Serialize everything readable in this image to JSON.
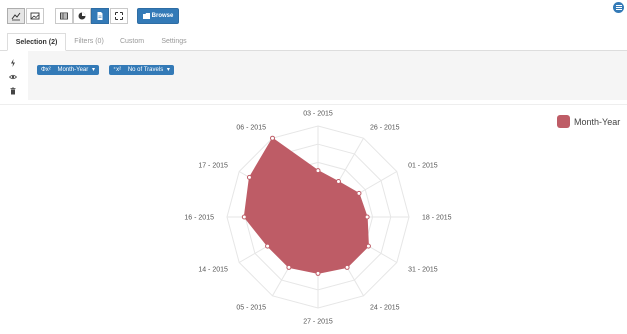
{
  "toolbar": {
    "buttons": [
      {
        "icon": "line-chart-icon",
        "state": "active"
      },
      {
        "icon": "image-icon",
        "state": "default"
      },
      {
        "icon": "table-icon",
        "state": "default"
      },
      {
        "icon": "pie-chart-icon",
        "state": "default"
      },
      {
        "icon": "document-icon",
        "state": "primary"
      },
      {
        "icon": "expand-icon",
        "state": "default"
      }
    ],
    "browse_label": "Browse",
    "menu_icon": "hamburger-icon"
  },
  "tabs": [
    {
      "label": "Selection (2)",
      "active": true
    },
    {
      "label": "Filters (0)",
      "active": false
    },
    {
      "label": "Custom",
      "active": false
    },
    {
      "label": "Settings",
      "active": false
    }
  ],
  "selection": {
    "side_icons": [
      "bolt-icon",
      "eye-icon",
      "trash-icon"
    ],
    "pills": [
      {
        "prefix": "Φx²",
        "label": "Month-Year"
      },
      {
        "prefix": "⁺x²",
        "label": "No of Travels"
      }
    ]
  },
  "colors": {
    "accent": "#337ab7",
    "series_fill": "#be5c66",
    "panel_bg": "#f5f5f5"
  },
  "chart_data": {
    "type": "radar",
    "categories": [
      "03 - 2015",
      "26 - 2015",
      "01 - 2015",
      "18 - 2015",
      "31 - 2015",
      "24 - 2015",
      "27 - 2015",
      "05 - 2015",
      "14 - 2015",
      "16 - 2015",
      "17 - 2015",
      "06 - 2015"
    ],
    "series": [
      {
        "name": "Month-Year",
        "values": [
          0.51,
          0.45,
          0.52,
          0.54,
          0.64,
          0.64,
          0.62,
          0.64,
          0.64,
          0.81,
          0.87,
          1.0
        ]
      }
    ],
    "rlim": [
      0,
      1
    ],
    "grid": true,
    "legend": "top-right"
  }
}
